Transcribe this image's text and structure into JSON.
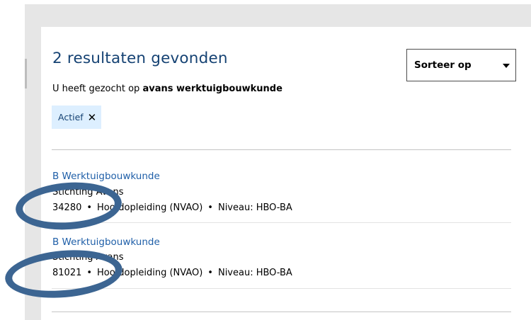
{
  "header": {
    "title": "2 resultaten gevonden"
  },
  "sort": {
    "label": "Sorteer op",
    "caret_icon": "chevron-down-icon"
  },
  "search": {
    "prefix": "U heeft gezocht op ",
    "query": "avans werktuigbouwkunde"
  },
  "filters": [
    {
      "label": "Actief",
      "remove_icon": "close-icon"
    }
  ],
  "results": [
    {
      "title": "B Werktuigbouwkunde",
      "organization": "Stichting Avans",
      "code": "34280",
      "separator": "•",
      "type": "Hoofdopleiding (NVAO)",
      "level": "Niveau: HBO-BA"
    },
    {
      "title": "B Werktuigbouwkunde",
      "organization": "Stichting Avans",
      "code": "81021",
      "separator": "•",
      "type": "Hoofdopleiding (NVAO)",
      "level": "Niveau: HBO-BA"
    }
  ],
  "colors": {
    "brand_blue": "#154273",
    "link_blue": "#1f5fa8",
    "chip_bg": "#ddefff",
    "annotation": "#3c6592",
    "background_gray": "#e6e6e6"
  }
}
